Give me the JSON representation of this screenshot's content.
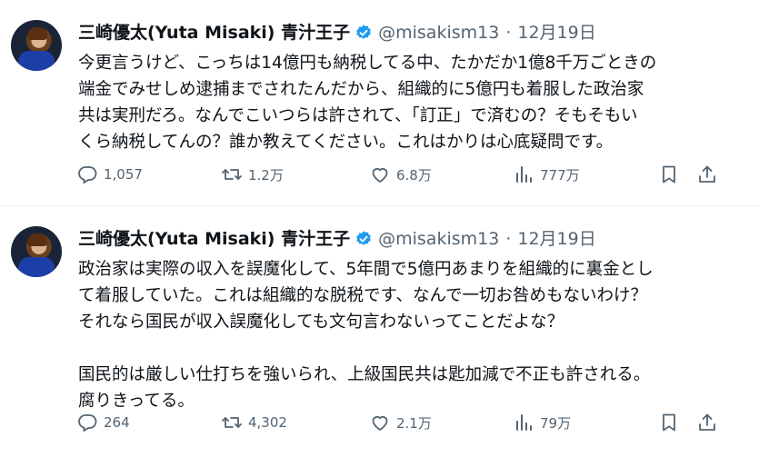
{
  "tweets": [
    {
      "author_name": "三崎優太(Yuta Misaki) 青汁王子",
      "handle": "@misakism13",
      "separator": "·",
      "date": "12月19日",
      "avatar_icon": "profile-avatar",
      "verified_icon": "verified-badge-icon",
      "text_lines": [
        "今更言うけど、こっちは14億円も納税してる中、たかだか1億8千万ごときの",
        "端金でみせしめ逮捕までされたんだから、組織的に5億円も着服した政治家",
        "共は実刑だろ。なんでこいつらは許されて、「訂正」で済むの？そもそもい",
        "くら納税してんの？誰か教えてください。これはかりは心底疑問です。"
      ],
      "stats": {
        "replies": "1,057",
        "reposts": "1.2万",
        "likes": "6.8万",
        "views": "777万"
      }
    },
    {
      "author_name": "三崎優太(Yuta Misaki) 青汁王子",
      "handle": "@misakism13",
      "separator": "·",
      "date": "12月19日",
      "avatar_icon": "profile-avatar",
      "verified_icon": "verified-badge-icon",
      "text_lines": [
        "政治家は実際の収入を誤魔化して、5年間で5億円あまりを組織的に裏金とし",
        "て着服していた。これは組織的な脱税です、なんで一切お咎めもないわけ？",
        "それなら国民が収入誤魔化しても文句言わないってことだよな？",
        "",
        "国民的は厳しい仕打ちを強いられ、上級国民共は匙加減で不正も許される。",
        "腐りきってる。"
      ],
      "stats": {
        "replies": "264",
        "reposts": "4,302",
        "likes": "2.1万",
        "views": "79万"
      }
    }
  ],
  "colors": {
    "text": "#0f1419",
    "secondary": "#536471",
    "verified": "#1d9bf0",
    "divider": "#eff3f4"
  },
  "icons": [
    "reply-icon",
    "repost-icon",
    "like-icon",
    "views-icon",
    "bookmark-icon",
    "share-icon"
  ]
}
